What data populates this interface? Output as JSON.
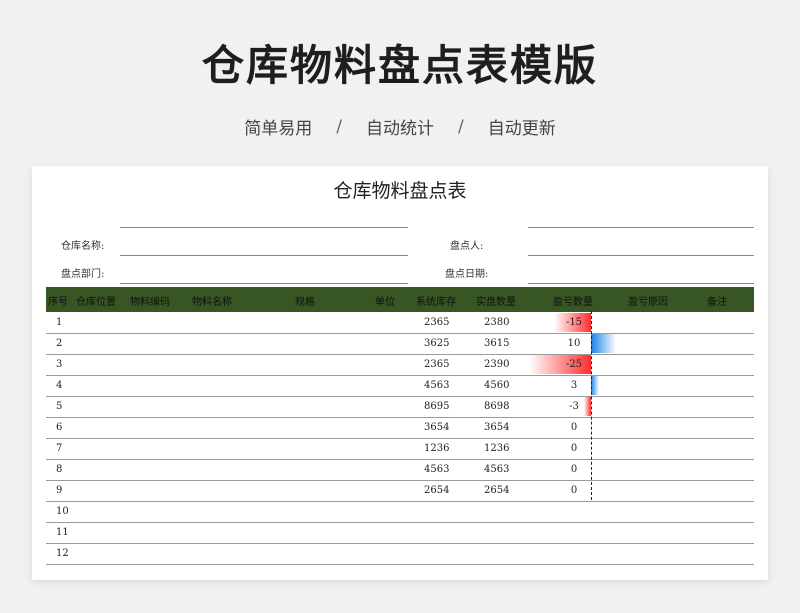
{
  "header": {
    "title": "仓库物料盘点表模版",
    "tags": [
      "简单易用",
      "自动统计",
      "自动更新"
    ],
    "separator": "/"
  },
  "sheet": {
    "title": "仓库物料盘点表",
    "fields": {
      "warehouse_name": "仓库名称:",
      "counter": "盘点人:",
      "department": "盘点部门:",
      "date": "盘点日期:"
    },
    "columns": [
      "序号",
      "仓库位置",
      "物料编码",
      "物料名称",
      "规格",
      "单位",
      "系统库存",
      "实盘数量",
      "盈亏数量",
      "盈亏原因",
      "备注"
    ],
    "rows": [
      {
        "no": "1",
        "system": "2365",
        "actual": "2380",
        "diff": "-15"
      },
      {
        "no": "2",
        "system": "3625",
        "actual": "3615",
        "diff": "10"
      },
      {
        "no": "3",
        "system": "2365",
        "actual": "2390",
        "diff": "-25"
      },
      {
        "no": "4",
        "system": "4563",
        "actual": "4560",
        "diff": "3"
      },
      {
        "no": "5",
        "system": "8695",
        "actual": "8698",
        "diff": "-3"
      },
      {
        "no": "6",
        "system": "3654",
        "actual": "3654",
        "diff": "0"
      },
      {
        "no": "7",
        "system": "1236",
        "actual": "1236",
        "diff": "0"
      },
      {
        "no": "8",
        "system": "4563",
        "actual": "4563",
        "diff": "0"
      },
      {
        "no": "9",
        "system": "2654",
        "actual": "2654",
        "diff": "0"
      },
      {
        "no": "10",
        "system": "",
        "actual": "",
        "diff": ""
      },
      {
        "no": "11",
        "system": "",
        "actual": "",
        "diff": ""
      },
      {
        "no": "12",
        "system": "",
        "actual": "",
        "diff": ""
      }
    ],
    "colors": {
      "header_bg": "#375623",
      "negative_bar": "#ff2d2d",
      "positive_bar": "#1a82e8"
    }
  }
}
